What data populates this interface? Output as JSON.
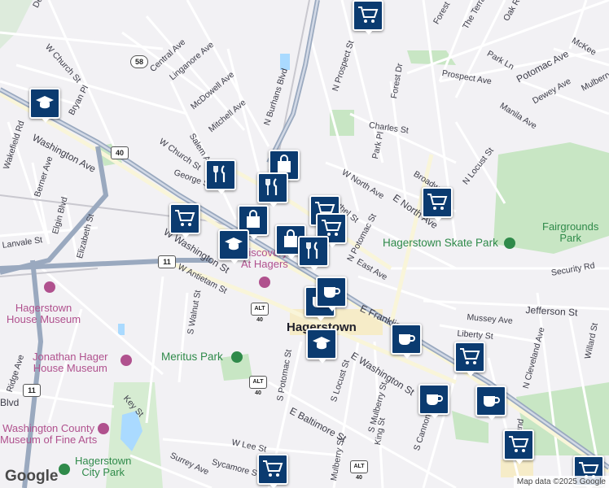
{
  "map": {
    "city_label": "Hagerstown",
    "attribution": "Map data ©2025 Google",
    "logo": "Google",
    "colors": {
      "background": "#f2f1f4",
      "park": "#c8e6c4",
      "water": "#aadaff",
      "highway": "#9aa9bf",
      "marker": "#0b3b70"
    }
  },
  "streets": [
    "Devonshire",
    "W Church St",
    "Central Ave",
    "Linganore Ave",
    "McDowell Ave",
    "Mitchell Ave",
    "N Burhans Blvd",
    "Bryan Pl",
    "Washington Ave",
    "Wakefield Rd",
    "Berner Ave",
    "Elgin Blvd",
    "Elizabeth St",
    "Lanvale St",
    "Salem Ave",
    "George St",
    "W Church St",
    "Prospect St",
    "N Prospect St",
    "Forest Dr",
    "Park Pl",
    "Charles St",
    "W North Ave",
    "E North Ave",
    "Bethel St",
    "N Locust St",
    "Broadway",
    "Prospect Ave",
    "Potomac Ave",
    "Dewey Ave",
    "Manila Ave",
    "Mulberry",
    "McKee",
    "Park Ln",
    "Oak Ridge",
    "Forest",
    "The Terrace",
    "N Potomac St",
    "East Ave",
    "Security Rd",
    "Jefferson St",
    "Mussey Ave",
    "Liberty St",
    "E Franklin",
    "E Washington St",
    "W Washington St",
    "W Antietam St",
    "S Walnut St",
    "S Potomac St",
    "S Locust St",
    "S Mulberry St",
    "King St",
    "S Cannon Ave",
    "N Cleveland Ave",
    "Willard St",
    "E Baltimore St",
    "W Lee St",
    "Sycamore St",
    "Surrey Ave",
    "Key St",
    "Ridge Ave",
    "Mulberry St",
    "Cleveland",
    "Blvd"
  ],
  "places": {
    "fairgrounds": "Fairgrounds\nPark",
    "skate_park": "Hagerstown Skate Park",
    "meritus": "Meritus Park",
    "hager_house": "Jonathan Hager\nHouse Museum",
    "hagerstown_house": "Hagerstown\nHouse Museum",
    "fine_arts": "Washington County\nMuseum of Fine Arts",
    "city_park": "Hagerstown\nCity Park",
    "discovery": "Discovery\nAt Hagers"
  },
  "shields": [
    "58",
    "40",
    "11",
    "ALT 40",
    "11",
    "ALT 40",
    "ALT 40"
  ],
  "markers": [
    {
      "icon": "cart-icon"
    },
    {
      "icon": "school-icon"
    },
    {
      "icon": "restaurant-icon"
    },
    {
      "icon": "shopping-bag-icon"
    },
    {
      "icon": "restaurant-icon"
    },
    {
      "icon": "cart-icon"
    },
    {
      "icon": "shopping-bag-icon"
    },
    {
      "icon": "cart-icon"
    },
    {
      "icon": "cart-icon"
    },
    {
      "icon": "school-icon"
    },
    {
      "icon": "cart-icon"
    },
    {
      "icon": "shopping-bag-icon"
    },
    {
      "icon": "restaurant-icon"
    },
    {
      "icon": "coffee-icon"
    },
    {
      "icon": "coffee-icon"
    },
    {
      "icon": "school-icon"
    },
    {
      "icon": "coffee-icon"
    },
    {
      "icon": "cart-icon"
    },
    {
      "icon": "coffee-icon"
    },
    {
      "icon": "coffee-icon"
    },
    {
      "icon": "cart-icon"
    },
    {
      "icon": "cart-icon"
    },
    {
      "icon": "cart-icon"
    }
  ]
}
